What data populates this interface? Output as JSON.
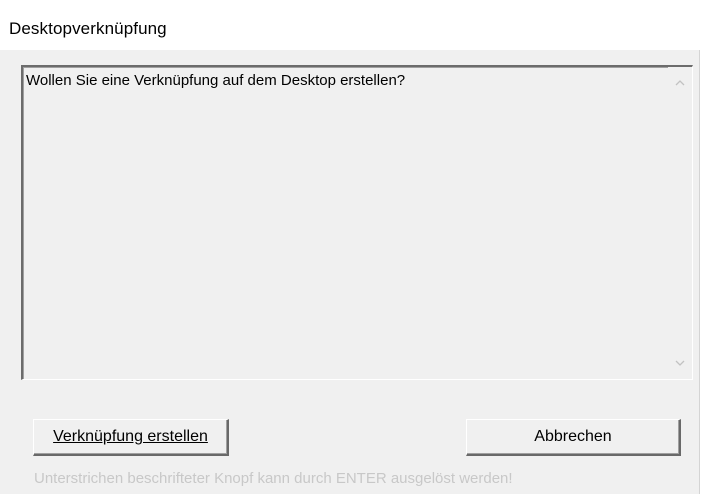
{
  "window": {
    "title": "Desktopverknüpfung"
  },
  "memo": {
    "text": "Wollen Sie eine Verknüpfung auf dem Desktop erstellen?",
    "scroll_up_icon": "chevron-up-icon",
    "scroll_down_icon": "chevron-down-icon"
  },
  "buttons": {
    "create_label": "Verknüpfung erstellen",
    "cancel_label": "Abbrechen"
  },
  "hint": {
    "text": "Unterstrichen beschrifteter Knopf kann durch ENTER ausgelöst werden!"
  },
  "colors": {
    "window_bg": "#f0f0f0",
    "titlebar_bg": "#ffffff",
    "hint_text": "#c8c8c8"
  }
}
